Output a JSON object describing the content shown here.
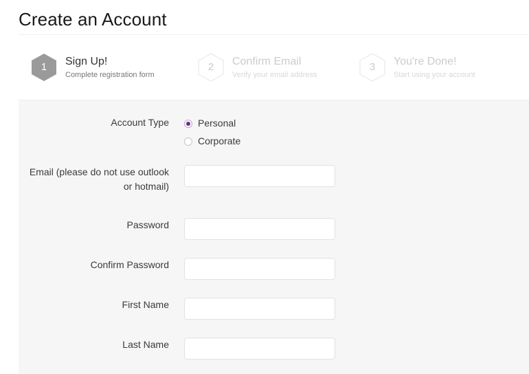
{
  "page": {
    "title": "Create an Account"
  },
  "steps": [
    {
      "number": "1",
      "title": "Sign Up!",
      "subtitle": "Complete registration form",
      "state": "active"
    },
    {
      "number": "2",
      "title": "Confirm Email",
      "subtitle": "Verify your email address",
      "state": "inactive"
    },
    {
      "number": "3",
      "title": "You're Done!",
      "subtitle": "Start using your account",
      "state": "inactive"
    }
  ],
  "form": {
    "account_type": {
      "label": "Account Type",
      "options": [
        {
          "label": "Personal",
          "selected": true
        },
        {
          "label": "Corporate",
          "selected": false
        }
      ]
    },
    "fields": [
      {
        "label": "Email (please do not use outlook or hotmail)",
        "value": "",
        "placeholder": ""
      },
      {
        "label": "Password",
        "value": "",
        "placeholder": ""
      },
      {
        "label": "Confirm Password",
        "value": "",
        "placeholder": ""
      },
      {
        "label": "First Name",
        "value": "",
        "placeholder": ""
      },
      {
        "label": "Last Name",
        "value": "",
        "placeholder": ""
      }
    ]
  },
  "colors": {
    "accent": "#6b2d8f",
    "panel_bg": "#f6f6f6",
    "active_step": "#9a9a9a",
    "inactive_step": "#e4e4e4"
  }
}
